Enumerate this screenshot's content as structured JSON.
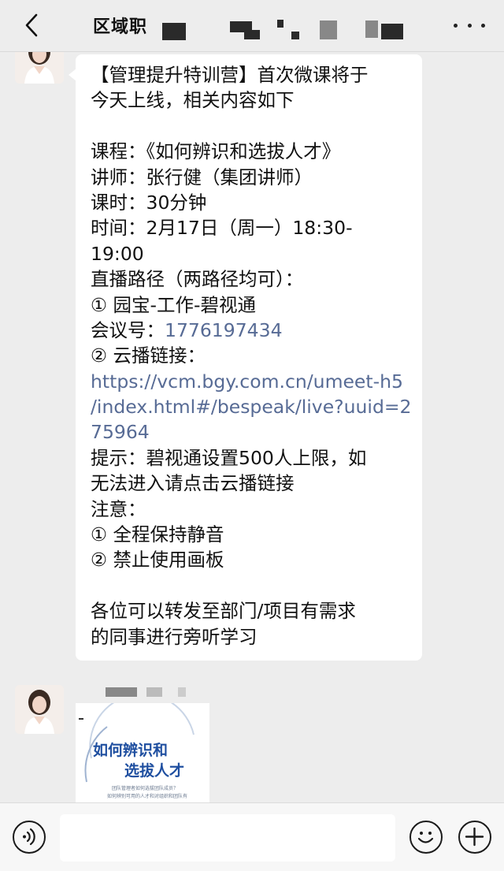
{
  "header": {
    "title": "区域职",
    "back_icon": "chevron-left-icon",
    "more_icon": "more-dots-icon"
  },
  "message": {
    "lines": [
      {
        "text": "【管理提升特训营】首次微课将于",
        "link": false
      },
      {
        "text": "今天上线，相关内容如下",
        "link": false
      },
      {
        "text": "",
        "link": false
      },
      {
        "text": "课程：《如何辨识和选拔人才》",
        "link": false
      },
      {
        "text": "讲师：张行健（集团讲师）",
        "link": false
      },
      {
        "text": "课时：30分钟",
        "link": false
      },
      {
        "text": "时间：2月17日（周一）18:30-",
        "link": false
      },
      {
        "text": "19:00",
        "link": false
      },
      {
        "text": "直播路径（两路径均可）：",
        "link": false
      },
      {
        "text": "① 园宝-工作-碧视通",
        "link": false
      },
      {
        "text": "会议号：",
        "link": false,
        "suffix": "1776197434"
      },
      {
        "text": "② 云播链接：",
        "link": false
      },
      {
        "text": "https://vcm.bgy.com.cn/umeet-h5",
        "link": true
      },
      {
        "text": "/index.html#/bespeak/live?uuid=2",
        "link": true
      },
      {
        "text": "75964",
        "link": true
      },
      {
        "text": "提示：碧视通设置500人上限，如",
        "link": false
      },
      {
        "text": "无法进入请点击云播链接",
        "link": false
      },
      {
        "text": "注意：",
        "link": false
      },
      {
        "text": "① 全程保持静音",
        "link": false
      },
      {
        "text": "② 禁止使用画板",
        "link": false
      },
      {
        "text": "",
        "link": false
      },
      {
        "text": "各位可以转发至部门/项目有需求",
        "link": false
      },
      {
        "text": "的同事进行旁听学习",
        "link": false
      }
    ]
  },
  "image_message": {
    "title_line1": "如何辨识和",
    "title_line2": "选拔人才",
    "caption_line1": "团队管理者如何选拔团队成员？",
    "caption_line2": "如何辨别可用的人才和对组织和团队有"
  },
  "colors": {
    "background": "#ededed",
    "bubble": "#ffffff",
    "link": "#576b95",
    "image_title": "#1f4fa0"
  },
  "inputbar": {
    "voice_icon": "voice-icon",
    "emoji_icon": "emoji-icon",
    "plus_icon": "plus-icon",
    "input_value": ""
  }
}
